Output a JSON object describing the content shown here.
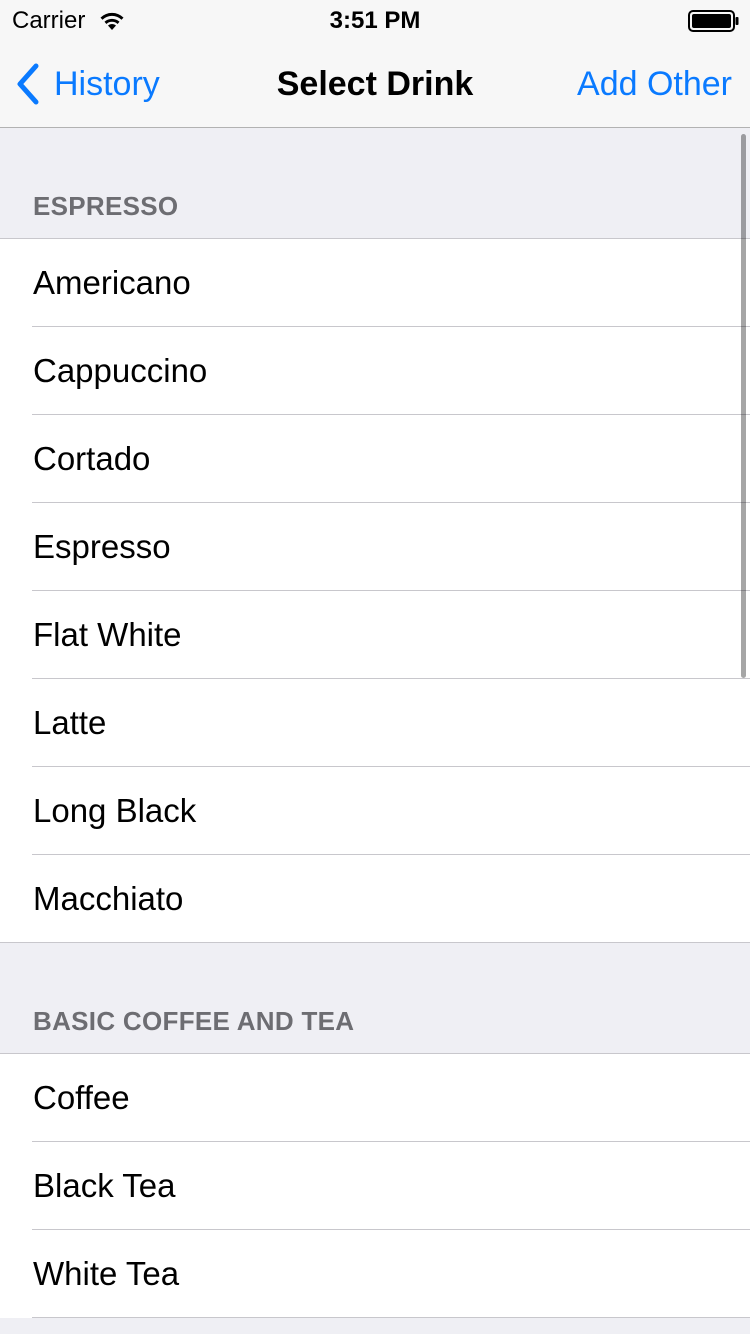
{
  "status_bar": {
    "carrier": "Carrier",
    "time": "3:51 PM"
  },
  "nav": {
    "back_label": "History",
    "title": "Select Drink",
    "right_label": "Add Other",
    "accent_color": "#0a7aff"
  },
  "sections": [
    {
      "header": "ESPRESSO",
      "items": [
        "Americano",
        "Cappuccino",
        "Cortado",
        "Espresso",
        "Flat White",
        "Latte",
        "Long Black",
        "Macchiato"
      ]
    },
    {
      "header": "BASIC COFFEE AND TEA",
      "items": [
        "Coffee",
        "Black Tea",
        "White Tea"
      ]
    }
  ],
  "icons": [
    "wifi-icon",
    "battery-icon",
    "chevron-left-icon"
  ]
}
